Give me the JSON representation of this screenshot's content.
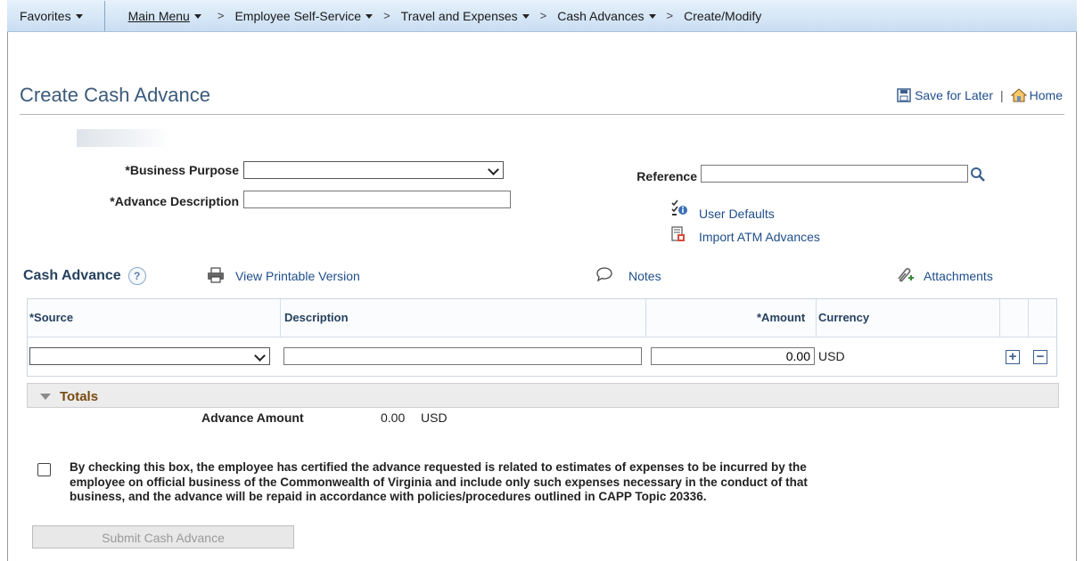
{
  "navbar": {
    "favorites": "Favorites",
    "main_menu": "Main Menu",
    "employee_self_service": "Employee Self-Service",
    "travel_and_expenses": "Travel and Expenses",
    "cash_advances": "Cash Advances",
    "create_modify": "Create/Modify",
    "separator": ">"
  },
  "page": {
    "title": "Create Cash Advance",
    "save_for_later": "Save for Later",
    "home": "Home",
    "pipe": "|"
  },
  "header_form": {
    "business_purpose_label": "*Business Purpose",
    "business_purpose_value": "",
    "advance_description_label": "*Advance Description",
    "advance_description_value": "",
    "reference_label": "Reference",
    "reference_value": "",
    "user_defaults": "User Defaults",
    "import_atm_advances": "Import ATM Advances"
  },
  "cash_advance": {
    "section_title": "Cash Advance",
    "help": "?",
    "view_printable_version": "View Printable Version",
    "notes": "Notes",
    "attachments": "Attachments",
    "columns": {
      "source": "*Source",
      "description": "Description",
      "amount": "*Amount",
      "currency": "Currency"
    },
    "rows": [
      {
        "source": "",
        "description": "",
        "amount": "0.00",
        "currency": "USD"
      }
    ]
  },
  "totals": {
    "title": "Totals",
    "advance_amount_label": "Advance Amount",
    "advance_amount_value": "0.00",
    "advance_amount_currency": "USD"
  },
  "certification": {
    "checked": false,
    "text": "By checking this box, the employee has certified the advance requested is related to estimates of expenses to be incurred by the employee on official business of the Commonwealth of Virginia and include only such expenses necessary in the conduct of that business, and the advance will be repaid in accordance with policies/procedures outlined in CAPP Topic 20336."
  },
  "actions": {
    "submit": "Submit Cash Advance"
  },
  "colors": {
    "link": "#1f4e8c",
    "title": "#3c5a7a",
    "totals_label": "#7a4a10",
    "navbar_top": "#e6f1fb",
    "navbar_bottom": "#c9def2"
  }
}
